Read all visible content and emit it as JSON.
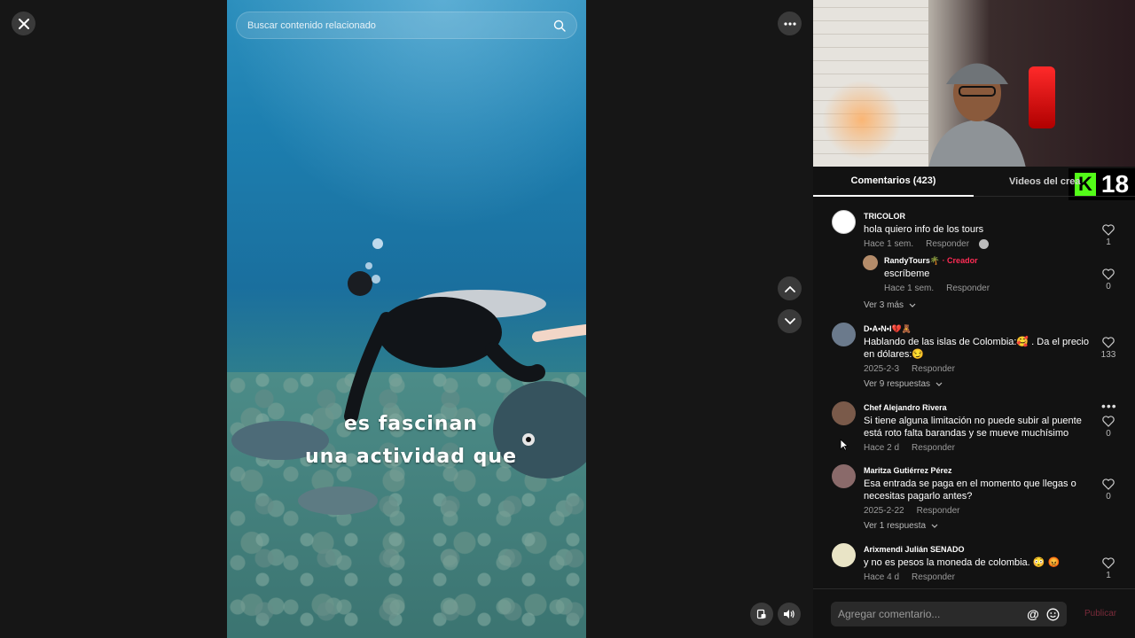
{
  "video": {
    "search_placeholder": "Buscar contenido relacionado",
    "caption_line1": "es fascinan",
    "caption_line2": "una actividad que"
  },
  "stream": {
    "badge_letter": "K",
    "badge_number": "18"
  },
  "tabs": {
    "comments_label": "Comentarios (423)",
    "videos_label": "Videos del crea"
  },
  "comments": [
    {
      "username": "TRICOLOR",
      "text": "hola quiero info de los tours",
      "date": "Hace 1 sem.",
      "reply_label": "Responder",
      "likes": "1"
    },
    {
      "username": "RandyTours🌴",
      "creator_label": "· Creador",
      "text": "escríbeme",
      "date": "Hace 1 sem.",
      "reply_label": "Responder",
      "likes": "0"
    },
    {
      "more_label": "Ver 3 más"
    },
    {
      "username": "D•A•N•I💔🧸",
      "text": "Hablando de las islas de Colombia:🥰 . Da el precio en dólares:😏",
      "date": "2025-2-3",
      "reply_label": "Responder",
      "likes": "133",
      "more_label": "Ver 9 respuestas"
    },
    {
      "username": "Chef Alejandro Rivera",
      "text": "Si tiene alguna limitación no puede subir al puente está roto falta barandas y se mueve muchísimo",
      "date": "Hace 2 d",
      "reply_label": "Responder",
      "likes": "0"
    },
    {
      "username": "Maritza Gutiérrez Pérez",
      "text": "Esa entrada se paga en el momento que llegas o necesitas pagarlo antes?",
      "date": "2025-2-22",
      "reply_label": "Responder",
      "likes": "0",
      "more_label": "Ver 1 respuesta"
    },
    {
      "username": "Arixmendi Julián SENADO",
      "text": "y no es pesos la moneda de colombia. 😳 😡",
      "date": "Hace 4 d",
      "reply_label": "Responder",
      "likes": "1"
    }
  ],
  "composer": {
    "placeholder": "Agregar comentario...",
    "mention_icon": "@",
    "publish_label": "Publicar"
  },
  "colors": {
    "accent": "#fe2c55",
    "kick_green": "#53fc18",
    "panel_bg": "#121212"
  }
}
